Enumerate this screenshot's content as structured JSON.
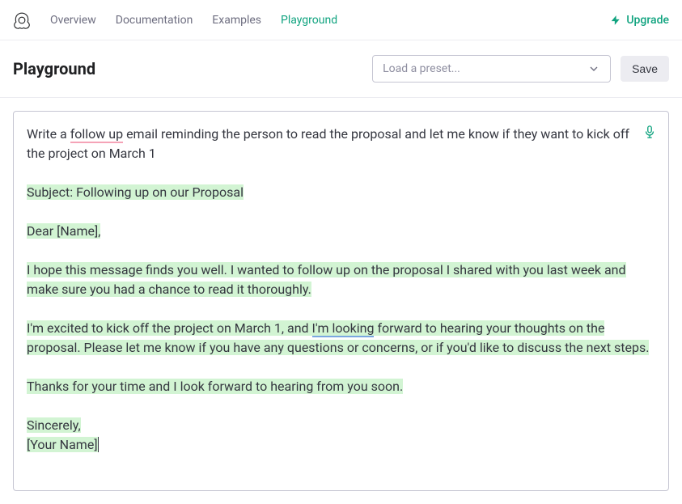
{
  "nav": {
    "links": [
      "Overview",
      "Documentation",
      "Examples",
      "Playground"
    ],
    "active": "Playground",
    "upgrade": "Upgrade"
  },
  "header": {
    "title": "Playground",
    "preset_placeholder": "Load a preset...",
    "save": "Save"
  },
  "editor": {
    "prompt_pre": "Write a ",
    "prompt_underlined": "follow up",
    "prompt_post": " email reminding the person to read the proposal and let me know if they want to kick off the project on March 1",
    "generated": {
      "subject": "Subject: Following up on our Proposal",
      "greeting": "Dear [Name],",
      "p1": "I hope this message finds you well. I wanted to follow up on the proposal I shared with you last week and make sure you had a chance to read it thoroughly.",
      "p2_a": "I'm excited to kick off the project on March 1, and ",
      "p2_u": "I'm looking",
      "p2_b": " forward to hearing your thoughts on the proposal. Please let me know if you have any questions or concerns, or if you'd like to discuss the next steps.",
      "p3": "Thanks for your time and I look forward to hearing from you soon.",
      "closing": "Sincerely,",
      "signature": "[Your Name]"
    }
  }
}
